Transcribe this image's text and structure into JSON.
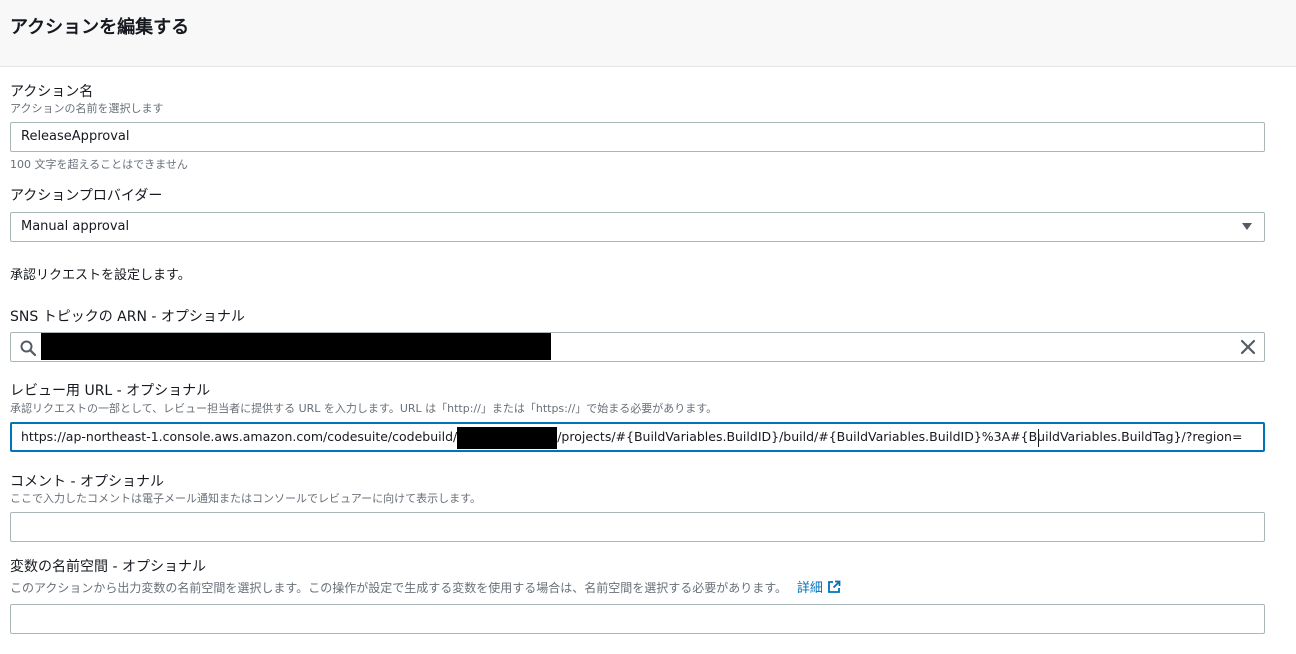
{
  "header": {
    "title": "アクションを編集する"
  },
  "action_name": {
    "label": "アクション名",
    "description": "アクションの名前を選択します",
    "value": "ReleaseApproval",
    "hint": "100 文字を超えることはできません"
  },
  "action_provider": {
    "label": "アクションプロバイダー",
    "selected": "Manual approval"
  },
  "approval_section": {
    "text": "承認リクエストを設定します。"
  },
  "sns_topic": {
    "label": "SNS トピックの ARN - オプショナル",
    "search_icon": "search-icon",
    "clear_icon": "close-icon"
  },
  "review_url": {
    "label": "レビュー用 URL - オプショナル",
    "description": "承認リクエストの一部として、レビュー担当者に提供する URL を入力します。URL は「http://」または「https://」で始まる必要があります。",
    "value_prefix": "https://ap-northeast-1.console.aws.amazon.com/codesuite/codebuild/",
    "value_suffix": "/projects/#{BuildVariables.BuildID}/build/#{BuildVariables.BuildID}%3A#{BuildVariables.BuildTag}/?region="
  },
  "comment": {
    "label": "コメント - オプショナル",
    "description": "ここで入力したコメントは電子メール通知またはコンソールでレビュアーに向けて表示します。",
    "value": ""
  },
  "variable_namespace": {
    "label": "変数の名前空間 - オプショナル",
    "description": "このアクションから出力変数の名前空間を選択します。この操作が設定で生成する変数を使用する場合は、名前空間を選択する必要があります。",
    "link_label": "詳細",
    "link_icon": "external-link-icon",
    "value": ""
  },
  "colors": {
    "accent": "#0073bb",
    "border": "#aab7b8",
    "text": "#16191f",
    "muted": "#687078"
  }
}
